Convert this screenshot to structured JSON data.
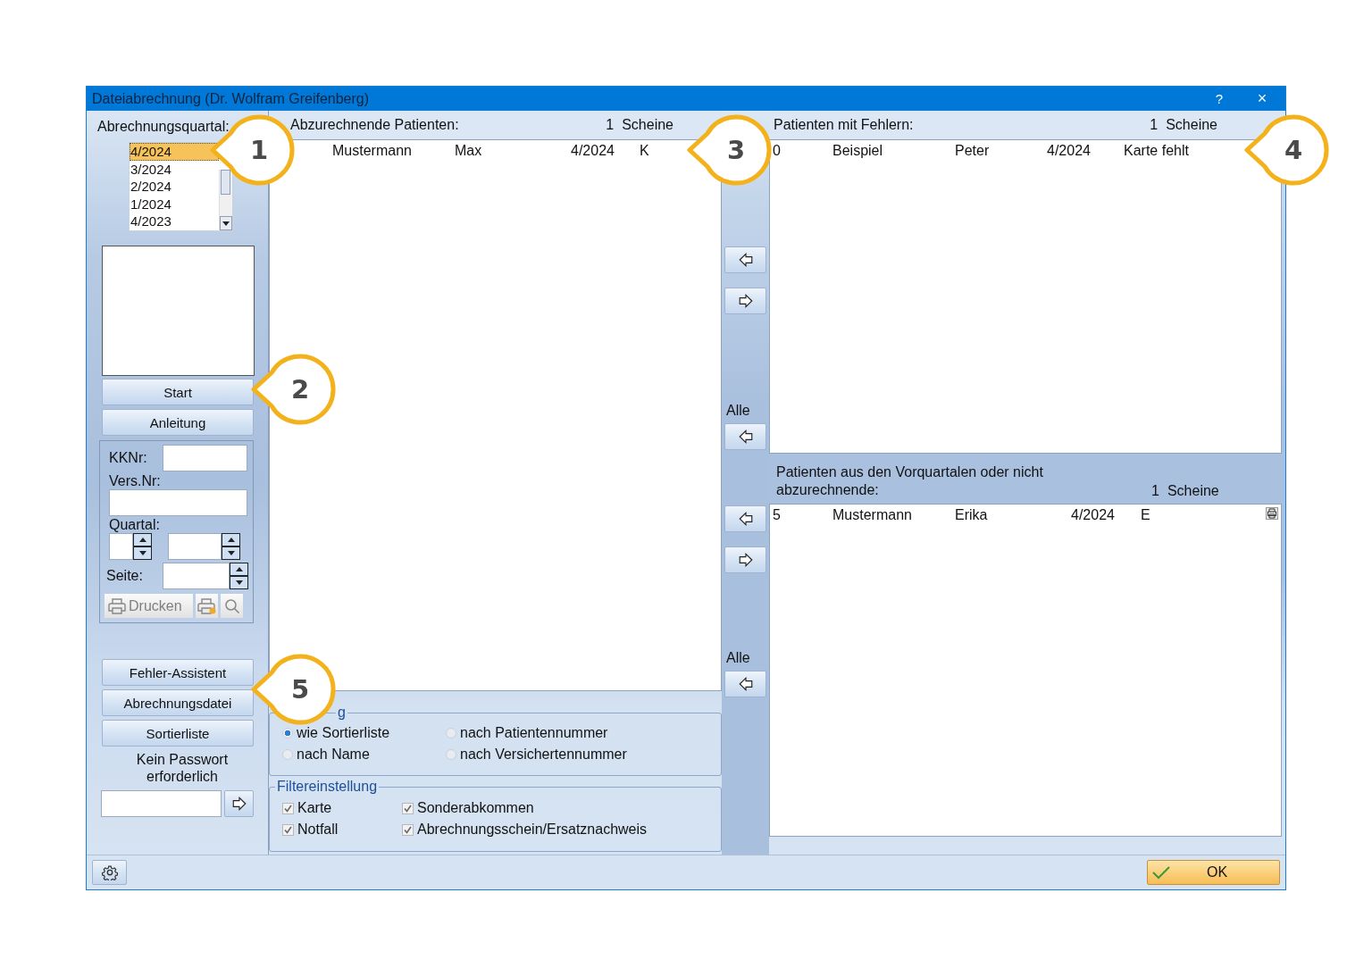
{
  "window": {
    "title": "Dateiabrechnung (Dr. Wolfram Greifenberg)",
    "help": "?",
    "close": "×"
  },
  "quarter_list": {
    "label": "Abrechnungsquartal:",
    "items": [
      {
        "text": "4/2024",
        "selected": true
      },
      {
        "text": "3/2024",
        "selected": false
      },
      {
        "text": "2/2024",
        "selected": false
      },
      {
        "text": "1/2024",
        "selected": false
      },
      {
        "text": "4/2023",
        "selected": false
      }
    ]
  },
  "actions": [
    "Start",
    "Anleitung"
  ],
  "search_group": {
    "kknr_label": "KKNr:",
    "vers_label": "Vers.Nr:",
    "quarter_label": "Quartal:",
    "page_label": "Seite:",
    "print_button": {
      "label": "Drucken",
      "disabled": true
    }
  },
  "tools": [
    "Fehler-Assistent",
    "Abrechnungsdatei",
    "Sortierliste"
  ],
  "password_note": "Kein Passwort erforderlich",
  "billing_list": {
    "title": "Abzurechnende Patienten:",
    "count": "1",
    "unit": "Scheine",
    "rows": [
      {
        "name": "Mustermann",
        "first_name": "Max",
        "quarter": "4/2024",
        "type": "K"
      }
    ]
  },
  "sorting": {
    "title": "g",
    "options": [
      {
        "label": "wie Sortierliste",
        "selected": true
      },
      {
        "label": "nach Patientennummer",
        "selected": false
      },
      {
        "label": "nach Name",
        "selected": false
      },
      {
        "label": "nach Versichertennummer",
        "selected": false
      }
    ]
  },
  "filter": {
    "title": "Filtereinstellung",
    "options": [
      {
        "label": "Karte",
        "checked": true
      },
      {
        "label": "Sonderabkommen",
        "checked": true
      },
      {
        "label": "Notfall",
        "checked": true
      },
      {
        "label": "Abrechnungsschein/Ersatznachweis",
        "checked": true
      }
    ]
  },
  "transfer_labels": [
    "Alle",
    "Alle"
  ],
  "error_list": {
    "title": "Patienten mit Fehlern:",
    "count": "1",
    "unit": "Scheine",
    "rows": [
      {
        "number": "0",
        "name": "Beispiel",
        "first_name": "Peter",
        "quarter": "4/2024",
        "error": "Karte fehlt"
      }
    ]
  },
  "other_list": {
    "title": "Patienten aus den Vorquartalen oder nicht abzurechnende:",
    "count": "1",
    "unit": "Scheine",
    "rows": [
      {
        "number": "5",
        "name": "Mustermann",
        "first_name": "Erika",
        "quarter": "4/2024",
        "type": "E"
      }
    ]
  },
  "ok_button": "OK",
  "callouts": [
    "1",
    "2",
    "3",
    "4",
    "5"
  ]
}
